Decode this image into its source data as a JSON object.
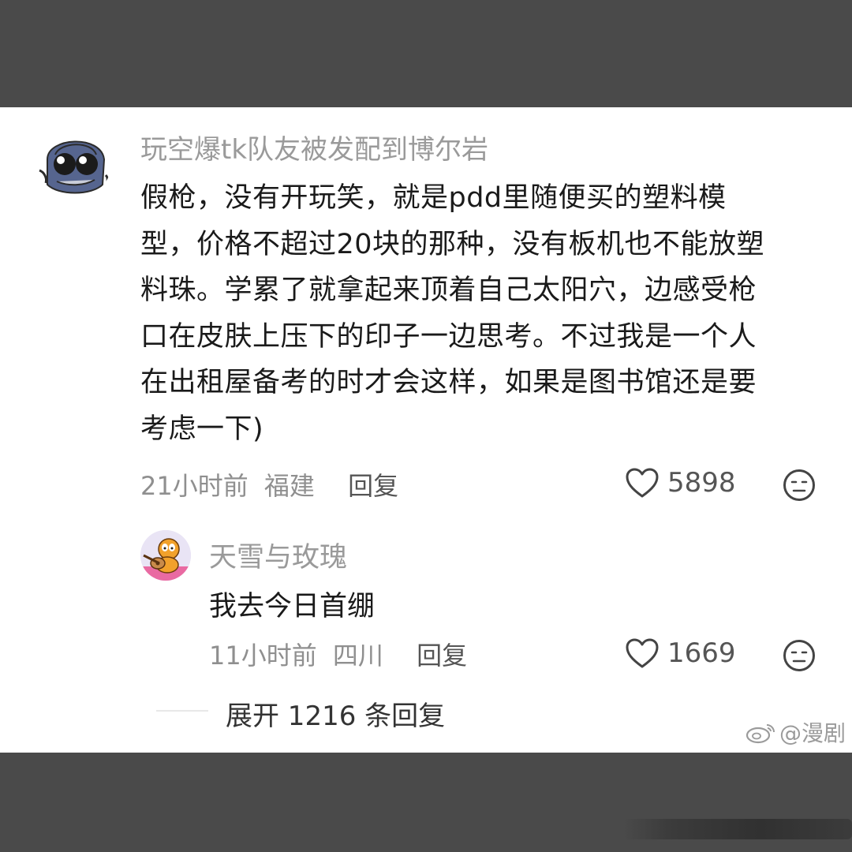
{
  "comment": {
    "username": "玩空爆tk队友被发配到博尔岩",
    "text_lines": [
      "假枪，没有开玩笑，就是pdd里随便买的塑料模",
      "型，价格不超过20块的那种，没有板机也不能放塑",
      "料珠。学累了就拿起来顶着自己太阳穴，边感受枪",
      "口在皮肤上压下的印子一边思考。不过我是一个人",
      "在出租屋备考的时才会这样，如果是图书馆还是要",
      "考虑一下)"
    ],
    "time": "21小时前",
    "location": "福建",
    "reply_label": "回复",
    "likes": "5898",
    "avatar_icon": "hooded-cartoon-avatar",
    "like_icon": "heart-outline-icon",
    "emoji_icon": "neutral-face-icon"
  },
  "reply": {
    "username": "天雪与玫瑰",
    "text": "我去今日首绷",
    "time": "11小时前",
    "location": "四川",
    "reply_label": "回复",
    "likes": "1669",
    "avatar_icon": "garfield-guitar-avatar"
  },
  "expand_label": "展开 1216 条回复",
  "watermark": "@漫剧",
  "colors": {
    "background_bar": "#4a4a4a",
    "card": "#ffffff",
    "username": "#9a9a9a",
    "text": "#1a1a1a",
    "meta": "#8f8f8f"
  }
}
